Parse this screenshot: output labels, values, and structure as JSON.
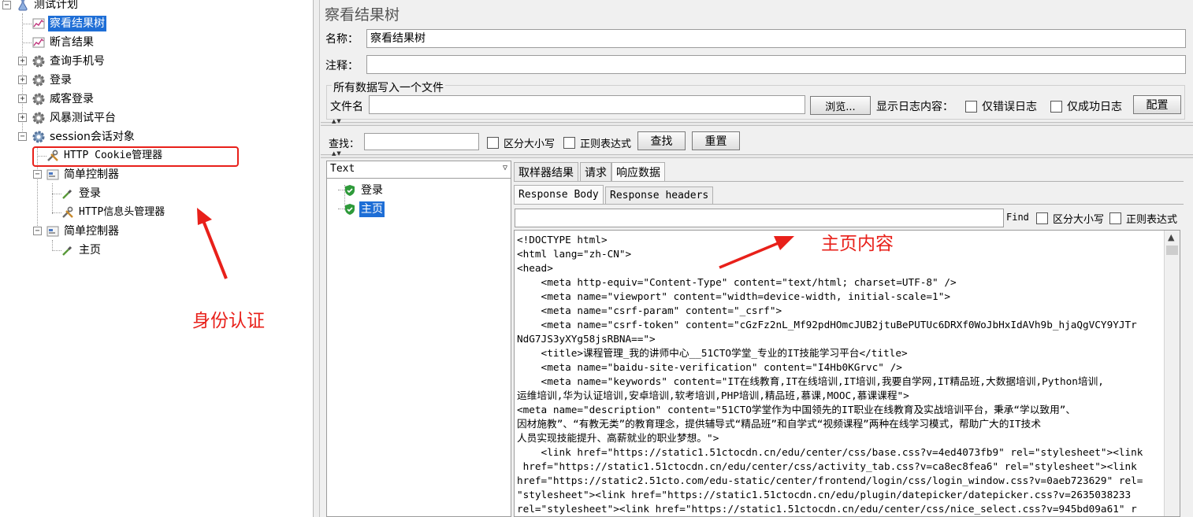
{
  "tree": {
    "root": "测试计划",
    "items": [
      {
        "label": "察看结果树",
        "selected": true
      },
      {
        "label": "断言结果"
      },
      {
        "label": "查询手机号"
      },
      {
        "label": "登录"
      },
      {
        "label": "威客登录"
      },
      {
        "label": "风暴测试平台"
      },
      {
        "label": "session会话对象"
      },
      {
        "label": "HTTP Cookie管理器"
      },
      {
        "label": "简单控制器"
      },
      {
        "label": "登录"
      },
      {
        "label": "HTTP信息头管理器"
      },
      {
        "label": "简单控制器"
      },
      {
        "label": "主页"
      }
    ]
  },
  "annotations": {
    "identity_label": "身份认证",
    "content_label": "主页内容",
    "color": "#e8201a"
  },
  "panel": {
    "title": "察看结果树",
    "name_label": "名称：",
    "name_value": "察看结果树",
    "comment_label": "注释：",
    "comment_value": "",
    "file_group_title": "所有数据写入一个文件",
    "file_label": "文件名",
    "file_value": "",
    "browse_button": "浏览...",
    "log_label": "显示日志内容：",
    "errors_only": "仅错误日志",
    "success_only": "仅成功日志",
    "config_button": "配置"
  },
  "search": {
    "label": "查找：",
    "value": "",
    "case_sensitive": "区分大小写",
    "regex": "正则表达式",
    "find_button": "查找",
    "reset_button": "重置"
  },
  "results": {
    "renderer": "Text",
    "samples": [
      {
        "label": "登录",
        "selected": false
      },
      {
        "label": "主页",
        "selected": true
      }
    ]
  },
  "detail": {
    "tabs": [
      "取样器结果",
      "请求",
      "响应数据"
    ],
    "active_tab": "响应数据",
    "subtabs": [
      "Response Body",
      "Response headers"
    ],
    "find_label": "Find",
    "find_value": "",
    "case_sensitive": "区分大小写",
    "regex": "正则表达式",
    "body_lines": [
      "<!DOCTYPE html>",
      "<html lang=\"zh-CN\">",
      "<head>",
      "    <meta http-equiv=\"Content-Type\" content=\"text/html; charset=UTF-8\" />",
      "    <meta name=\"viewport\" content=\"width=device-width, initial-scale=1\">",
      "    <meta name=\"csrf-param\" content=\"_csrf\">",
      "    <meta name=\"csrf-token\" content=\"cGzFz2nL_Mf92pdHOmcJUB2jtuBePUTUc6DRXf0WoJbHxIdAVh9b_hjaQgVCY9YJTr",
      "NdG7JS3yXYg58jsRBNA==\">",
      "    <title>课程管理_我的讲师中心__51CTO学堂_专业的IT技能学习平台</title>",
      "    <meta name=\"baidu-site-verification\" content=\"I4Hb0KGrvc\" />",
      "    <meta name=\"keywords\" content=\"IT在线教育,IT在线培训,IT培训,我要自学网,IT精品班,大数据培训,Python培训,",
      "运维培训,华为认证培训,安卓培训,软考培训,PHP培训,精品班,慕课,MOOC,慕课课程\">",
      "<meta name=\"description\" content=\"51CTO学堂作为中国领先的IT职业在线教育及实战培训平台，秉承“学以致用”、",
      "因材施教”、“有教无类”的教育理念，提供辅导式“精品班”和自学式“视频课程”两种在线学习模式，帮助广大的IT技术",
      "人员实现技能提升、高薪就业的职业梦想。\">",
      "    <link href=\"https://static1.51ctocdn.cn/edu/center/css/base.css?v=4ed4073fb9\" rel=\"stylesheet\"><link",
      " href=\"https://static1.51ctocdn.cn/edu/center/css/activity_tab.css?v=ca8ec8fea6\" rel=\"stylesheet\"><link",
      "href=\"https://static2.51cto.com/edu-static/center/frontend/login/css/login_window.css?v=0aeb723629\" rel=",
      "\"stylesheet\"><link href=\"https://static1.51ctocdn.cn/edu/plugin/datepicker/datepicker.css?v=2635038233",
      "rel=\"stylesheet\"><link href=\"https://static1.51ctocdn.cn/edu/center/css/nice_select.css?v=945bd09a61\" r"
    ]
  }
}
